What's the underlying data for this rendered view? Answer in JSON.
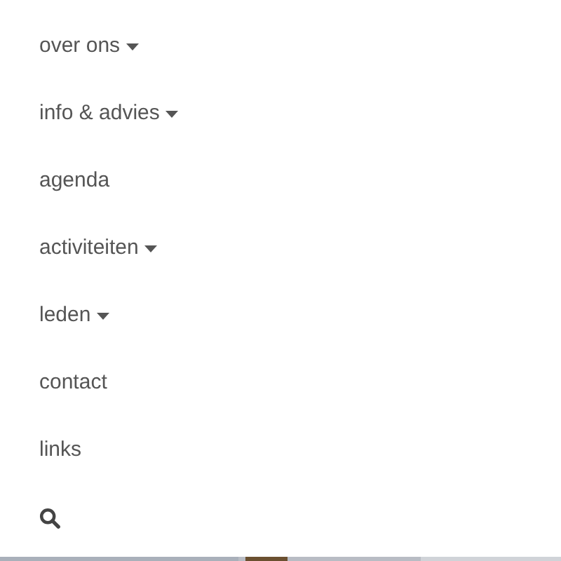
{
  "menu": [
    {
      "label": "over ons",
      "has_dropdown": true
    },
    {
      "label": "info & advies",
      "has_dropdown": true
    },
    {
      "label": "agenda",
      "has_dropdown": false
    },
    {
      "label": "activiteiten",
      "has_dropdown": true
    },
    {
      "label": "leden",
      "has_dropdown": true
    },
    {
      "label": "contact",
      "has_dropdown": false
    },
    {
      "label": "links",
      "has_dropdown": false
    }
  ]
}
